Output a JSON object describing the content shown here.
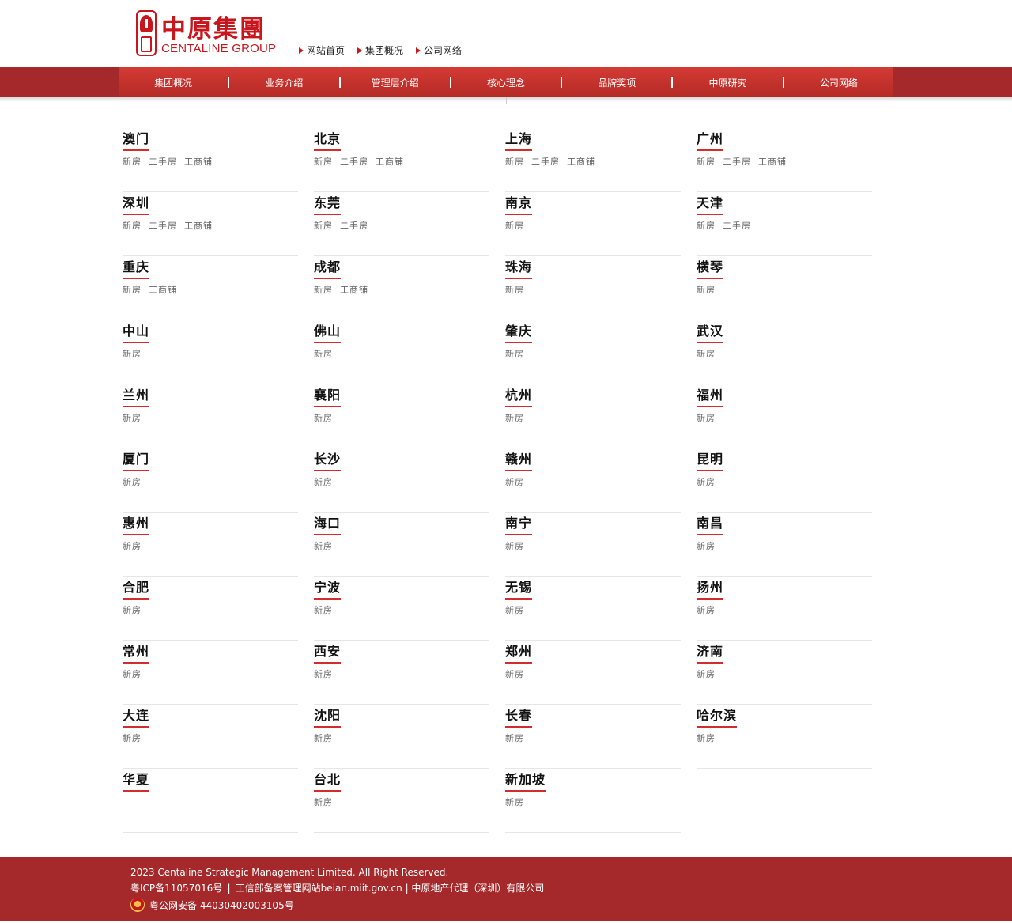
{
  "header": {
    "logo_cn": "中原集團",
    "logo_en": "CENTALINE GROUP",
    "top_links": [
      "网站首页",
      "集团概况",
      "公司网络"
    ]
  },
  "nav": {
    "items": [
      "集团概况",
      "业务介绍",
      "管理层介绍",
      "核心理念",
      "品牌奖项",
      "中原研究",
      "公司网络"
    ],
    "separator": "|"
  },
  "cities": [
    {
      "name": "澳门",
      "links": [
        "新房",
        "二手房",
        "工商铺"
      ]
    },
    {
      "name": "北京",
      "links": [
        "新房",
        "二手房",
        "工商铺"
      ]
    },
    {
      "name": "上海",
      "links": [
        "新房",
        "二手房",
        "工商铺"
      ]
    },
    {
      "name": "广州",
      "links": [
        "新房",
        "二手房",
        "工商铺"
      ]
    },
    {
      "name": "深圳",
      "links": [
        "新房",
        "二手房",
        "工商铺"
      ]
    },
    {
      "name": "东莞",
      "links": [
        "新房",
        "二手房"
      ]
    },
    {
      "name": "南京",
      "links": [
        "新房"
      ]
    },
    {
      "name": "天津",
      "links": [
        "新房",
        "二手房"
      ]
    },
    {
      "name": "重庆",
      "links": [
        "新房",
        "工商铺"
      ]
    },
    {
      "name": "成都",
      "links": [
        "新房",
        "工商铺"
      ]
    },
    {
      "name": "珠海",
      "links": [
        "新房"
      ]
    },
    {
      "name": "横琴",
      "links": [
        "新房"
      ]
    },
    {
      "name": "中山",
      "links": [
        "新房"
      ]
    },
    {
      "name": "佛山",
      "links": [
        "新房"
      ]
    },
    {
      "name": "肇庆",
      "links": [
        "新房"
      ]
    },
    {
      "name": "武汉",
      "links": [
        "新房"
      ]
    },
    {
      "name": "兰州",
      "links": [
        "新房"
      ]
    },
    {
      "name": "襄阳",
      "links": [
        "新房"
      ]
    },
    {
      "name": "杭州",
      "links": [
        "新房"
      ]
    },
    {
      "name": "福州",
      "links": [
        "新房"
      ]
    },
    {
      "name": "厦门",
      "links": [
        "新房"
      ]
    },
    {
      "name": "长沙",
      "links": [
        "新房"
      ]
    },
    {
      "name": "赣州",
      "links": [
        "新房"
      ]
    },
    {
      "name": "昆明",
      "links": [
        "新房"
      ]
    },
    {
      "name": "惠州",
      "links": [
        "新房"
      ]
    },
    {
      "name": "海口",
      "links": [
        "新房"
      ]
    },
    {
      "name": "南宁",
      "links": [
        "新房"
      ]
    },
    {
      "name": "南昌",
      "links": [
        "新房"
      ]
    },
    {
      "name": "合肥",
      "links": [
        "新房"
      ]
    },
    {
      "name": "宁波",
      "links": [
        "新房"
      ]
    },
    {
      "name": "无锡",
      "links": [
        "新房"
      ]
    },
    {
      "name": "扬州",
      "links": [
        "新房"
      ]
    },
    {
      "name": "常州",
      "links": [
        "新房"
      ]
    },
    {
      "name": "西安",
      "links": [
        "新房"
      ]
    },
    {
      "name": "郑州",
      "links": [
        "新房"
      ]
    },
    {
      "name": "济南",
      "links": [
        "新房"
      ]
    },
    {
      "name": "大连",
      "links": [
        "新房"
      ]
    },
    {
      "name": "沈阳",
      "links": [
        "新房"
      ]
    },
    {
      "name": "长春",
      "links": [
        "新房"
      ]
    },
    {
      "name": "哈尔滨",
      "links": [
        "新房"
      ]
    },
    {
      "name": "华夏",
      "links": []
    },
    {
      "name": "台北",
      "links": [
        "新房"
      ]
    },
    {
      "name": "新加坡",
      "links": [
        "新房"
      ]
    }
  ],
  "footer": {
    "copyright": "2023 Centaline Strategic Management Limited. All Right Reserved.",
    "icp": "粤ICP备11057016号",
    "icp_sep": "|",
    "miit": "工信部备案管理网站beian.miit.gov.cn | 中原地产代理（深圳）有限公司",
    "police": "粤公网安备 44030402003105号"
  },
  "colors": {
    "brand_red": "#c8161d",
    "nav_bar": "#a5282a",
    "nav_inner": "#d33a34"
  }
}
